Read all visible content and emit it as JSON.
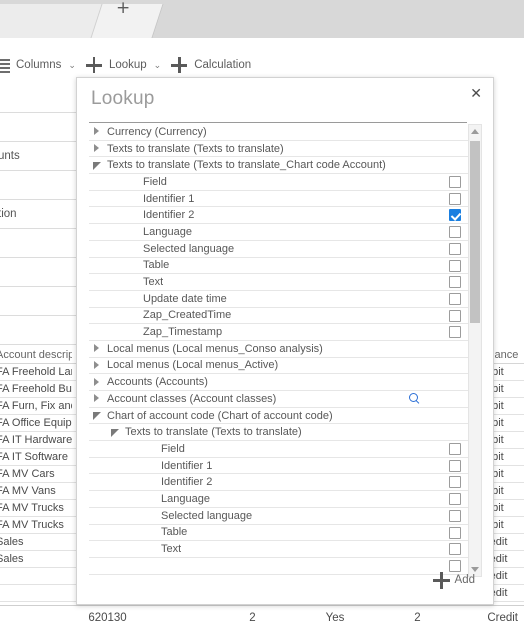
{
  "browser": {
    "new_tab_label": "+"
  },
  "toolbar": {
    "columns_label": "Columns",
    "columns_caret": "⌄",
    "lookup_label": "Lookup",
    "lookup_caret": "⌄",
    "calculation_label": "Calculation"
  },
  "left_panel": {
    "rows": [
      {
        "label": ""
      },
      {
        "label": ""
      },
      {
        "label": "unts"
      },
      {
        "label": ""
      },
      {
        "label": "tion"
      },
      {
        "label": ""
      },
      {
        "label": ""
      },
      {
        "label": ""
      },
      {
        "label": ""
      }
    ]
  },
  "grid": {
    "header": {
      "description": "Account descrip",
      "balance": "alance"
    },
    "rows": [
      {
        "description": "FA Freehold Lan",
        "balance": "ebit"
      },
      {
        "description": "FA Freehold Bui",
        "balance": "ebit"
      },
      {
        "description": "FA Furn, Fix and",
        "balance": "ebit"
      },
      {
        "description": "FA Office Equipn",
        "balance": "ebit"
      },
      {
        "description": "FA IT Hardware",
        "balance": "ebit"
      },
      {
        "description": "FA IT Software",
        "balance": "ebit"
      },
      {
        "description": "FA MV Cars",
        "balance": "ebit"
      },
      {
        "description": "FA MV Vans",
        "balance": "ebit"
      },
      {
        "description": "FA MV Trucks",
        "balance": "ebit"
      },
      {
        "description": "FA MV Trucks",
        "balance": "ebit"
      },
      {
        "description": "Sales",
        "balance": "redit"
      },
      {
        "description": "Sales",
        "balance": "redit"
      },
      {
        "description": "",
        "balance": "redit"
      },
      {
        "description": "",
        "balance": "redit"
      }
    ]
  },
  "bottom_row": {
    "account": "620130",
    "col2": "2",
    "col3": "Yes",
    "col4": "2",
    "balance": "Credit"
  },
  "dialog": {
    "title": "Lookup",
    "close_label": "✕",
    "add_label": "Add",
    "tree": [
      {
        "label": "Currency (Currency)",
        "indent": 0,
        "state": "collapsed",
        "checkbox": null,
        "search": false
      },
      {
        "label": "Texts to translate (Texts to translate)",
        "indent": 0,
        "state": "collapsed",
        "checkbox": null,
        "search": false
      },
      {
        "label": "Texts to translate (Texts to translate_Chart code Account)",
        "indent": 0,
        "state": "expanded",
        "checkbox": null,
        "search": false
      },
      {
        "label": "Field",
        "indent": 2,
        "state": "none",
        "checkbox": false,
        "search": false
      },
      {
        "label": "Identifier 1",
        "indent": 2,
        "state": "none",
        "checkbox": false,
        "search": false
      },
      {
        "label": "Identifier 2",
        "indent": 2,
        "state": "none",
        "checkbox": true,
        "search": false
      },
      {
        "label": "Language",
        "indent": 2,
        "state": "none",
        "checkbox": false,
        "search": false
      },
      {
        "label": "Selected language",
        "indent": 2,
        "state": "none",
        "checkbox": false,
        "search": false
      },
      {
        "label": "Table",
        "indent": 2,
        "state": "none",
        "checkbox": false,
        "search": false
      },
      {
        "label": "Text",
        "indent": 2,
        "state": "none",
        "checkbox": false,
        "search": false
      },
      {
        "label": "Update date time",
        "indent": 2,
        "state": "none",
        "checkbox": false,
        "search": false
      },
      {
        "label": "Zap_CreatedTime",
        "indent": 2,
        "state": "none",
        "checkbox": false,
        "search": false
      },
      {
        "label": "Zap_Timestamp",
        "indent": 2,
        "state": "none",
        "checkbox": false,
        "search": false
      },
      {
        "label": "Local menus (Local menus_Conso analysis)",
        "indent": 0,
        "state": "collapsed",
        "checkbox": null,
        "search": false
      },
      {
        "label": "Local menus (Local menus_Active)",
        "indent": 0,
        "state": "collapsed",
        "checkbox": null,
        "search": false
      },
      {
        "label": "Accounts (Accounts)",
        "indent": 0,
        "state": "collapsed",
        "checkbox": null,
        "search": false
      },
      {
        "label": "Account classes (Account classes)",
        "indent": 0,
        "state": "collapsed",
        "checkbox": null,
        "search": true
      },
      {
        "label": "Chart of account code (Chart of account code)",
        "indent": 0,
        "state": "expanded",
        "checkbox": null,
        "search": false
      },
      {
        "label": "Texts to translate (Texts to translate)",
        "indent": 1,
        "state": "expanded",
        "checkbox": null,
        "search": false
      },
      {
        "label": "Field",
        "indent": 3,
        "state": "none",
        "checkbox": false,
        "search": false
      },
      {
        "label": "Identifier 1",
        "indent": 3,
        "state": "none",
        "checkbox": false,
        "search": false
      },
      {
        "label": "Identifier 2",
        "indent": 3,
        "state": "none",
        "checkbox": false,
        "search": false
      },
      {
        "label": "Language",
        "indent": 3,
        "state": "none",
        "checkbox": false,
        "search": false
      },
      {
        "label": "Selected language",
        "indent": 3,
        "state": "none",
        "checkbox": false,
        "search": false
      },
      {
        "label": "Table",
        "indent": 3,
        "state": "none",
        "checkbox": false,
        "search": false
      },
      {
        "label": "Text",
        "indent": 3,
        "state": "none",
        "checkbox": false,
        "search": false
      },
      {
        "label": "",
        "indent": 3,
        "state": "none",
        "checkbox": false,
        "search": false
      }
    ]
  },
  "colors": {
    "accent": "#1a7fe0",
    "chrome": "#d8d8d8",
    "dialog_border": "#d2d2d2",
    "link": "#2b6fd6"
  }
}
